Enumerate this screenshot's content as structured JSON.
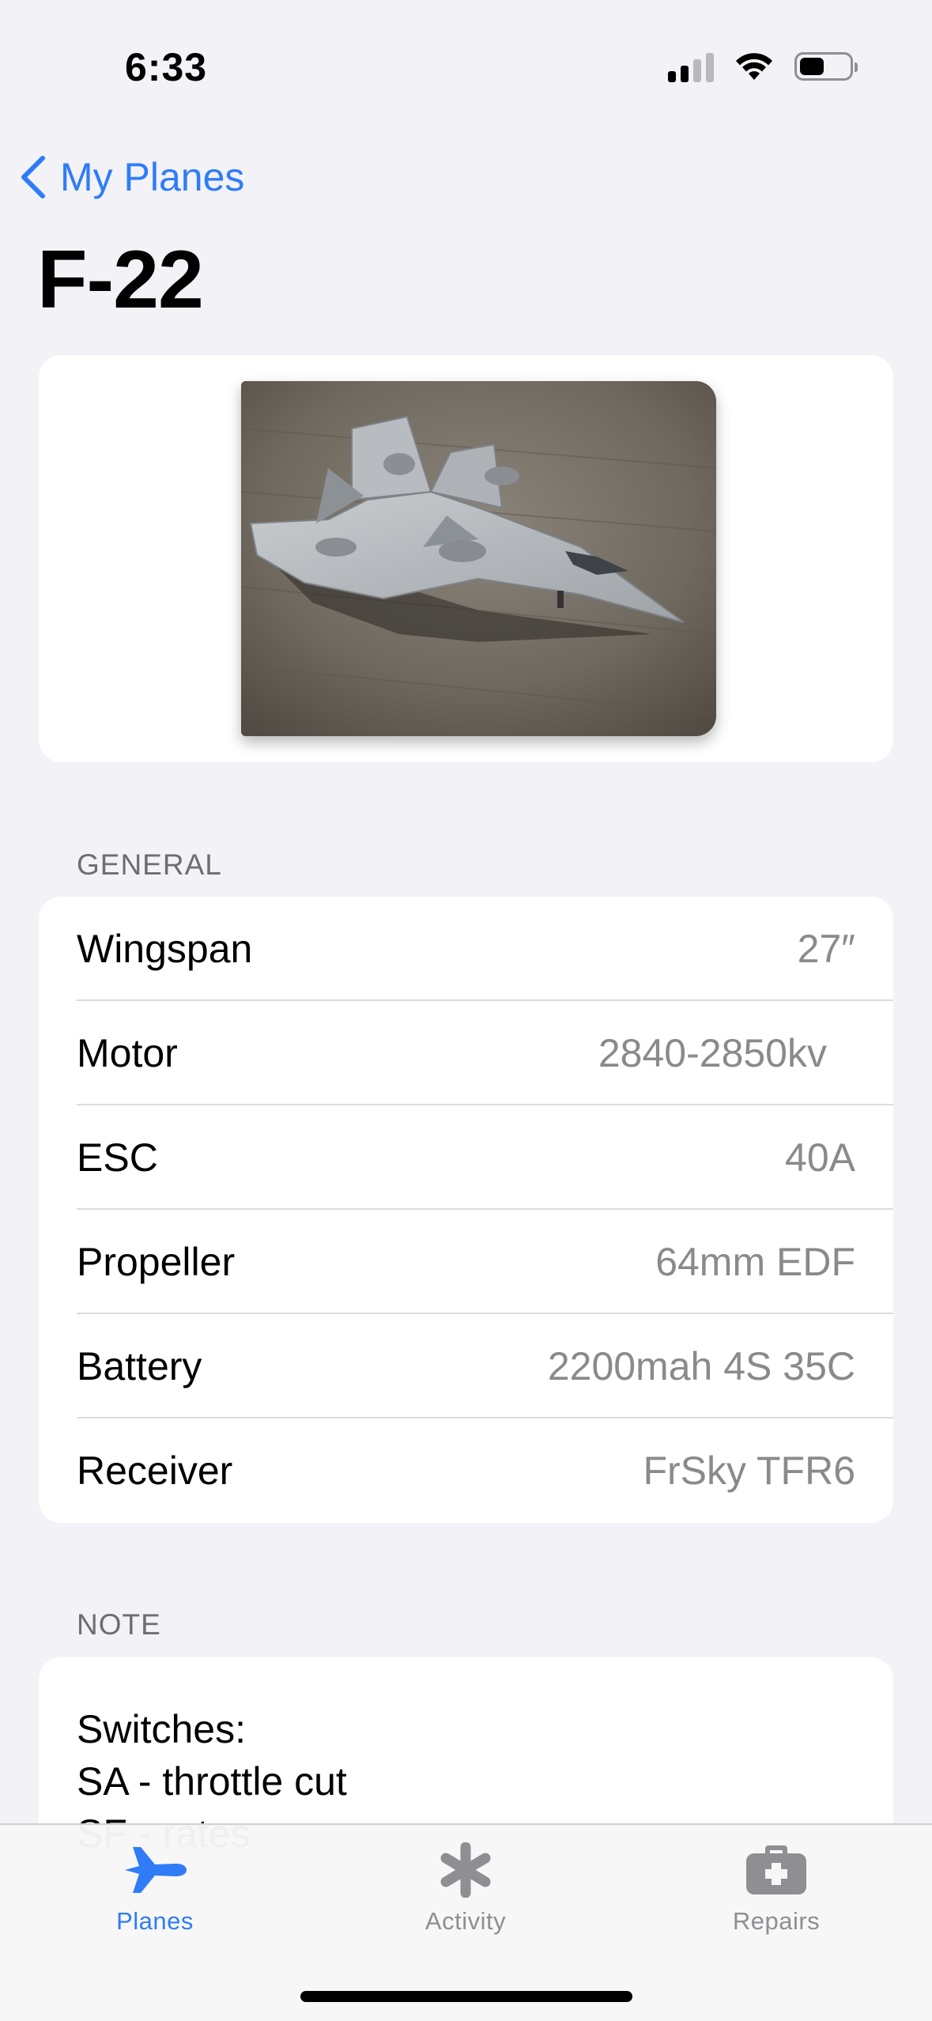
{
  "status_bar": {
    "time": "6:33"
  },
  "nav": {
    "back_label": "My Planes",
    "title": "F-22"
  },
  "photo": {
    "description_icon": "f22-jet-photo"
  },
  "general": {
    "header": "GENERAL",
    "rows": [
      {
        "label": "Wingspan",
        "value": "27″"
      },
      {
        "label": "Motor",
        "value": "2840-2850kv"
      },
      {
        "label": "ESC",
        "value": "40A"
      },
      {
        "label": "Propeller",
        "value": "64mm EDF"
      },
      {
        "label": "Battery",
        "value": "2200mah 4S 35C"
      },
      {
        "label": "Receiver",
        "value": "FrSky TFR6"
      }
    ]
  },
  "note": {
    "header": "NOTE",
    "text": "Switches:\nSA - throttle cut\nSF - rates"
  },
  "tab_bar": {
    "tabs": [
      {
        "label": "Planes",
        "icon": "airplane-icon",
        "active": true
      },
      {
        "label": "Activity",
        "icon": "asterisk-icon",
        "active": false
      },
      {
        "label": "Repairs",
        "icon": "first-aid-kit-icon",
        "active": false
      }
    ]
  },
  "colors": {
    "accent": "#2f7cf6",
    "background": "#f2f2f7",
    "secondary_text": "#8a8a8e"
  }
}
